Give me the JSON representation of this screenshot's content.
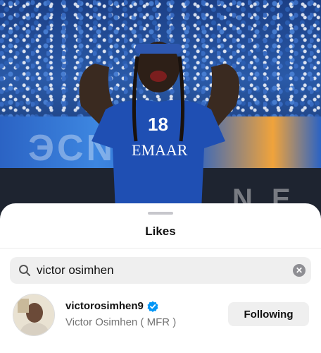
{
  "sheet": {
    "title": "Likes"
  },
  "search": {
    "value": "victor osimhen",
    "clear_icon": "clear-icon"
  },
  "results": [
    {
      "username": "victorosimhen9",
      "verified": true,
      "full_name": "Victor Osimhen ( MFR )",
      "follow_label": "Following"
    }
  ],
  "photo": {
    "jersey_number": "18",
    "jersey_sponsor": "EMAAR",
    "banner_text": "ЭСN2",
    "lower_text": "N E"
  },
  "colors": {
    "verified_blue": "#0095f6",
    "button_bg": "#efefef",
    "jersey_blue": "#1f4fb3"
  }
}
